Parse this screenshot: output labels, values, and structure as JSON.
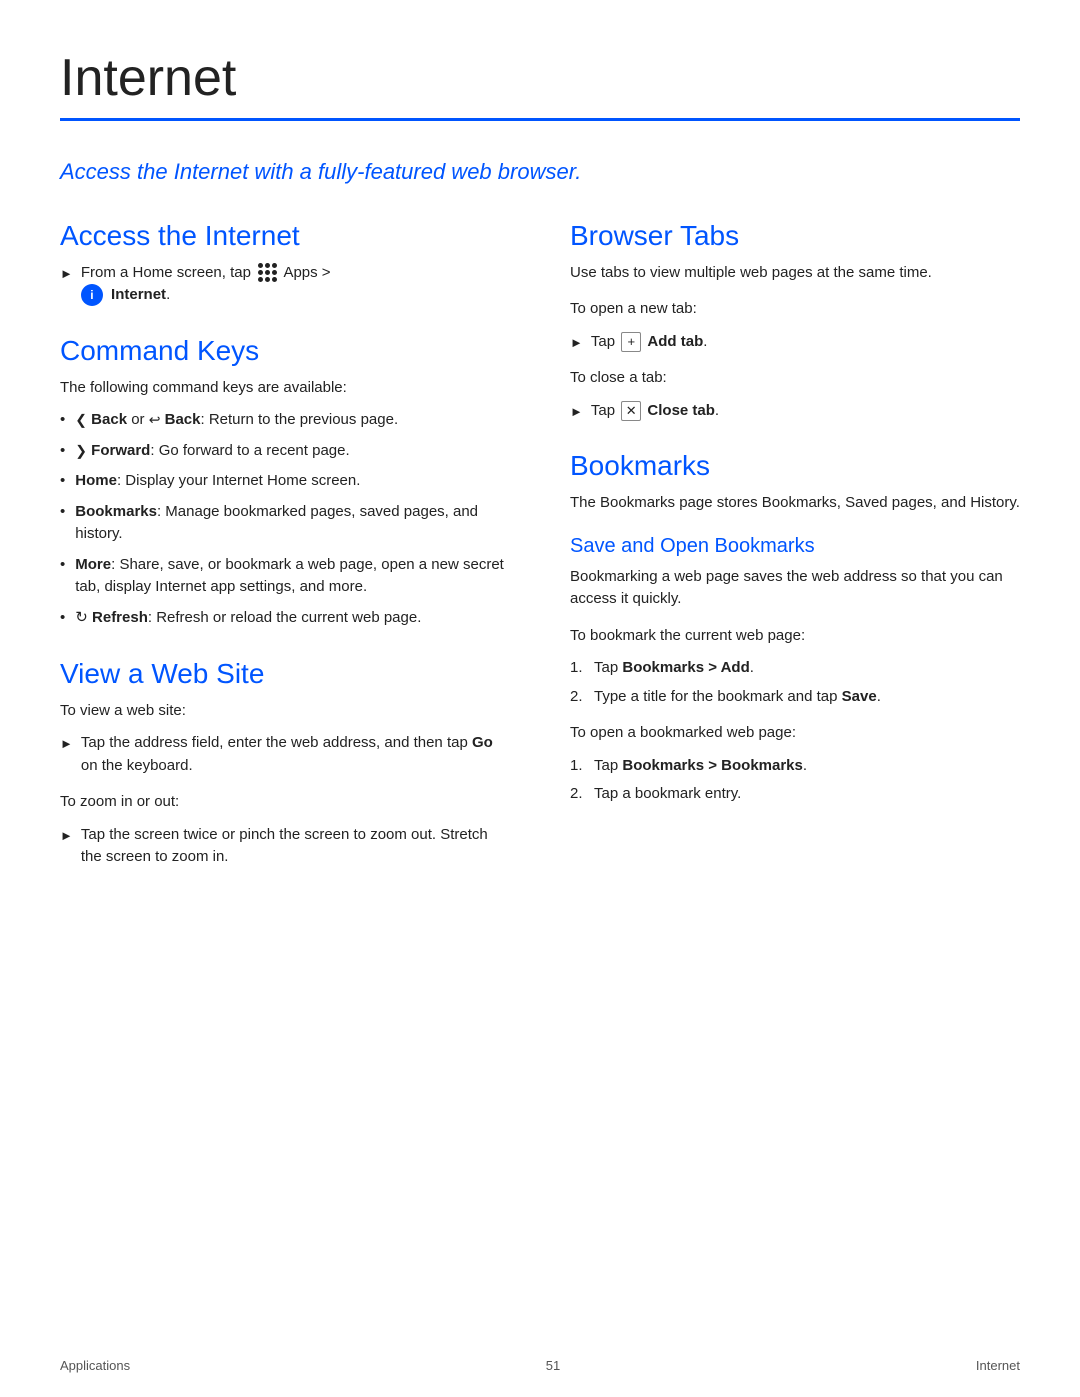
{
  "page": {
    "title": "Internet",
    "footer": {
      "left": "Applications",
      "center": "51",
      "right": "Internet"
    }
  },
  "intro": {
    "text": "Access the Internet with a fully-featured web browser."
  },
  "left_col": {
    "access_title": "Access the Internet",
    "access_step": "From a Home screen, tap",
    "access_apps": "Apps >",
    "access_internet": "Internet",
    "command_title": "Command Keys",
    "command_intro": "The following command keys are available:",
    "commands": [
      {
        "label": "Back",
        "connector": "or",
        "label2": "Back",
        "desc": ": Return to the previous page."
      },
      {
        "label": "Forward",
        "desc": ": Go forward to a recent page."
      },
      {
        "label": "Home",
        "desc": ": Display your Internet Home screen."
      },
      {
        "label": "Bookmarks",
        "desc": ": Manage bookmarked pages, saved pages, and history."
      },
      {
        "label": "More",
        "desc": ": Share, save, or bookmark a web page, open a new secret tab, display Internet app settings, and more."
      },
      {
        "label": "Refresh",
        "desc": ": Refresh or reload the current web page.",
        "icon": "refresh"
      }
    ],
    "webview_title": "View a Web Site",
    "webview_intro": "To view a web site:",
    "webview_step1": "Tap the address field, enter the web address, and then tap",
    "webview_go": "Go",
    "webview_step1_end": "on the keyboard.",
    "webview_intro2": "To zoom in or out:",
    "webview_step2": "Tap the screen twice or pinch the screen to zoom out. Stretch the screen to zoom in."
  },
  "right_col": {
    "browser_tabs_title": "Browser Tabs",
    "browser_tabs_desc": "Use tabs to view multiple web pages at the same time.",
    "new_tab_intro": "To open a new tab:",
    "new_tab_step": "Tap",
    "add_tab_label": "Add tab",
    "close_tab_intro": "To close a tab:",
    "close_tab_step": "Tap",
    "close_tab_label": "Close tab",
    "bookmarks_title": "Bookmarks",
    "bookmarks_desc": "The Bookmarks page stores Bookmarks, Saved pages, and History.",
    "save_open_title": "Save and Open Bookmarks",
    "save_open_desc": "Bookmarking a web page saves the web address so that you can access it quickly.",
    "bookmark_current_intro": "To bookmark the current web page:",
    "bookmark_steps": [
      {
        "text": "Tap ",
        "bold": "Bookmarks > Add",
        "end": "."
      },
      {
        "text": "Type a title for the bookmark and tap ",
        "bold": "Save",
        "end": "."
      }
    ],
    "open_bookmarked_intro": "To open a bookmarked web page:",
    "open_bookmark_steps": [
      {
        "text": "Tap ",
        "bold": "Bookmarks > Bookmarks",
        "end": "."
      },
      {
        "text": "Tap a bookmark entry.",
        "bold": "",
        "end": ""
      }
    ]
  }
}
